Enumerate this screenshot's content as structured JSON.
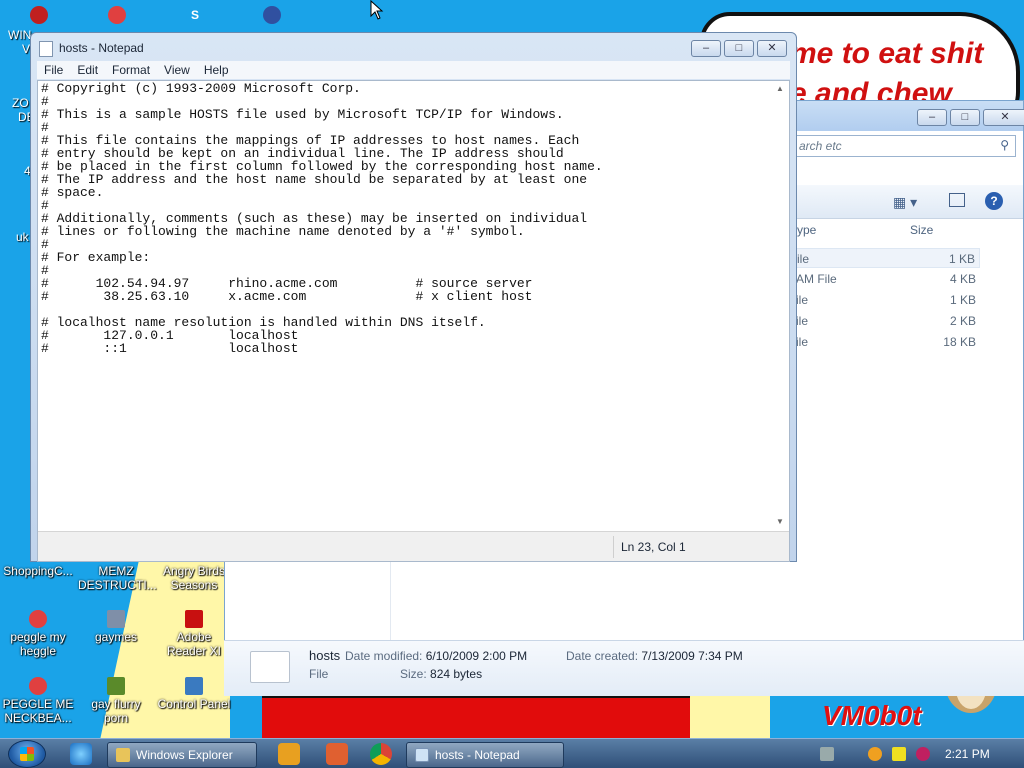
{
  "wallpaper": {
    "bubble_line1": "me to eat shit",
    "bubble_line2": "e and chew",
    "logo": "VM0b0t"
  },
  "desktop": {
    "edge_labels": [
      "WIN",
      "V",
      "ZO",
      "DE",
      "4",
      "uk"
    ],
    "icons": [
      {
        "label": "ShoppingC...",
        "color": "#2a7bd4"
      },
      {
        "label": "MEMZ DESTRUCTI...",
        "color": "#8a8a8a"
      },
      {
        "label": "Angry Birds Seasons",
        "color": "#d93a2b"
      },
      {
        "label": "peggle my heggle",
        "color": "#e04040"
      },
      {
        "label": "gaymes",
        "color": "#7f8fa8"
      },
      {
        "label": "Adobe Reader XI",
        "color": "#c81010"
      },
      {
        "label": "PEGGLE ME NECKBEA...",
        "color": "#e04040"
      },
      {
        "label": "gay flurry porn",
        "color": "#5a8a2a"
      },
      {
        "label": "Control Panel",
        "color": "#3a7ac0"
      }
    ]
  },
  "explorer": {
    "search_placeholder": "arch etc",
    "columns": {
      "type": "ype",
      "size": "Size"
    },
    "rows": [
      {
        "type": "ile",
        "size": "1 KB"
      },
      {
        "type": "AM File",
        "size": "4 KB"
      },
      {
        "type": "ile",
        "size": "1 KB"
      },
      {
        "type": "ile",
        "size": "2 KB"
      },
      {
        "type": "ile",
        "size": "18 KB"
      }
    ],
    "details": {
      "name": "hosts",
      "type": "File",
      "date_modified_label": "Date modified:",
      "date_modified": "6/10/2009 2:00 PM",
      "date_created_label": "Date created:",
      "date_created": "7/13/2009 7:34 PM",
      "size_label": "Size:",
      "size": "824 bytes"
    }
  },
  "notepad": {
    "title": "hosts - Notepad",
    "menu": [
      "File",
      "Edit",
      "Format",
      "View",
      "Help"
    ],
    "content": "# Copyright (c) 1993-2009 Microsoft Corp.\n#\n# This is a sample HOSTS file used by Microsoft TCP/IP for Windows.\n#\n# This file contains the mappings of IP addresses to host names. Each\n# entry should be kept on an individual line. The IP address should\n# be placed in the first column followed by the corresponding host name.\n# The IP address and the host name should be separated by at least one\n# space.\n#\n# Additionally, comments (such as these) may be inserted on individual\n# lines or following the machine name denoted by a '#' symbol.\n#\n# For example:\n#\n#      102.54.94.97     rhino.acme.com          # source server\n#       38.25.63.10     x.acme.com              # x client host\n\n# localhost name resolution is handled within DNS itself.\n#\t127.0.0.1       localhost\n#\t::1             localhost",
    "status": "Ln 23, Col 1"
  },
  "taskbar": {
    "tasks": [
      {
        "label": "Windows Explorer"
      },
      {
        "label": "hosts - Notepad"
      }
    ],
    "clock": "2:21 PM"
  }
}
